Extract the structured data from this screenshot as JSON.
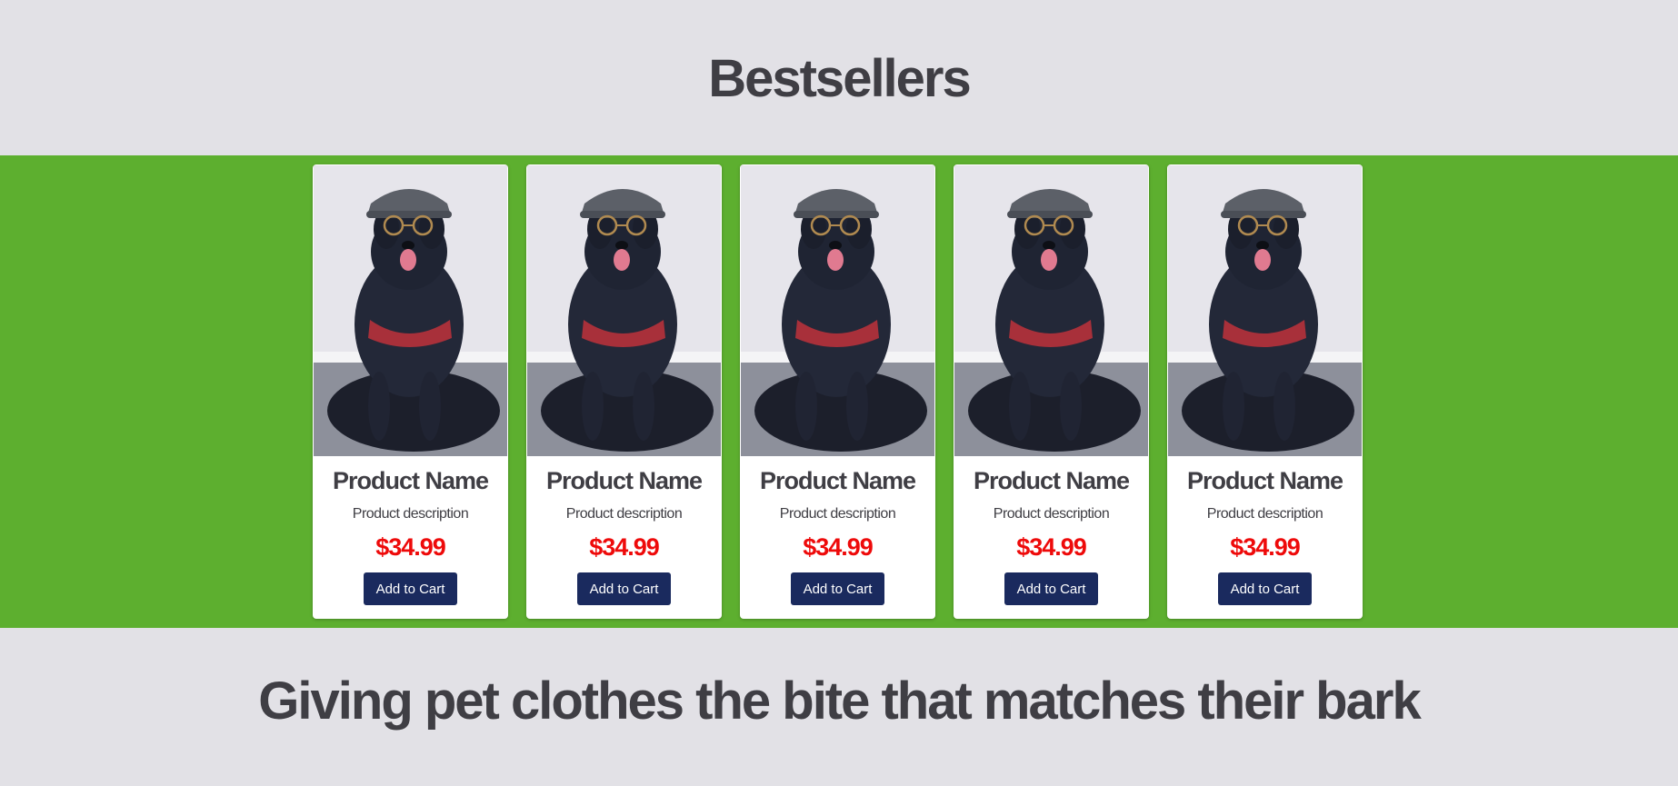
{
  "header": {
    "title": "Bestsellers"
  },
  "colors": {
    "band_green": "#5daf2f",
    "page_bg": "#e2e1e6",
    "price_red": "#ee0a0a",
    "button_navy": "#1a2a5e",
    "text_dark": "#3f3e44"
  },
  "products": [
    {
      "name": "Product Name",
      "description": "Product description",
      "price": "$34.99",
      "button_label": "Add to Cart",
      "image_icon": "dog-with-cap-and-glasses-photo"
    },
    {
      "name": "Product Name",
      "description": "Product description",
      "price": "$34.99",
      "button_label": "Add to Cart",
      "image_icon": "dog-with-cap-and-glasses-photo"
    },
    {
      "name": "Product Name",
      "description": "Product description",
      "price": "$34.99",
      "button_label": "Add to Cart",
      "image_icon": "dog-with-cap-and-glasses-photo"
    },
    {
      "name": "Product Name",
      "description": "Product description",
      "price": "$34.99",
      "button_label": "Add to Cart",
      "image_icon": "dog-with-cap-and-glasses-photo"
    },
    {
      "name": "Product Name",
      "description": "Product description",
      "price": "$34.99",
      "button_label": "Add to Cart",
      "image_icon": "dog-with-cap-and-glasses-photo"
    }
  ],
  "tagline": {
    "text": "Giving pet clothes the bite that matches their bark"
  }
}
